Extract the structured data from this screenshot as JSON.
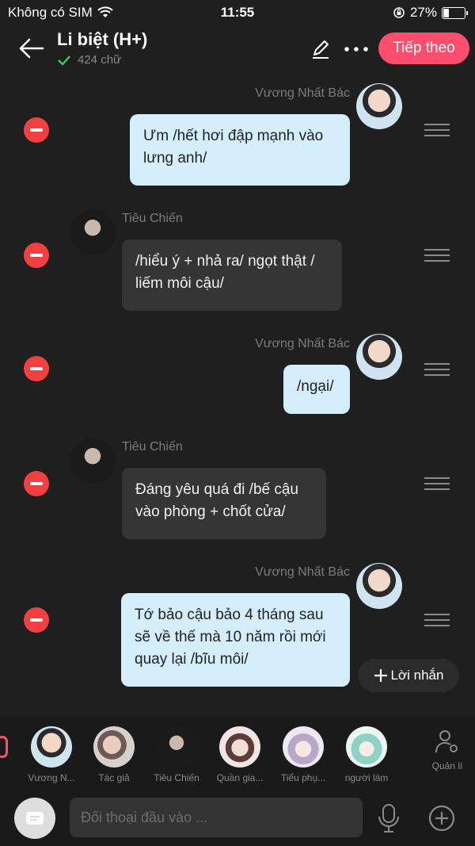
{
  "status": {
    "carrier": "Không có SIM",
    "time": "11:55",
    "battery": "27%"
  },
  "header": {
    "title": "Li biệt (H+)",
    "word_count": "424 chữ",
    "next_label": "Tiếp theo"
  },
  "messages": [
    {
      "sender": "Vương Nhất Bác",
      "text": "Ưm /hết hơi đập mạnh vào lưng anh/",
      "side": "right"
    },
    {
      "sender": "Tiêu Chiến",
      "text": "/hiểu ý + nhả ra/ ngọt thật / liếm môi cậu/",
      "side": "left"
    },
    {
      "sender": "Vương Nhất Bác",
      "text": "/ngại/",
      "side": "right"
    },
    {
      "sender": "Tiêu Chiến",
      "text": "Đáng yêu quá đi /bế cậu vào phòng + chốt cửa/",
      "side": "left"
    },
    {
      "sender": "Vương Nhất Bác",
      "text": "Tớ bảo cậu bảo 4 tháng sau sẽ về thế mà 10 năm rồi mới quay lại /bĩu môi/",
      "side": "right"
    }
  ],
  "add_message_label": "Lời nhắn",
  "characters": [
    {
      "name": "Vương N..."
    },
    {
      "name": "Tác giả"
    },
    {
      "name": "Tiêu Chiến"
    },
    {
      "name": "Quần gia..."
    },
    {
      "name": "Tiểu phụ..."
    },
    {
      "name": "người làm"
    }
  ],
  "manage_label": "Quản lí",
  "input": {
    "placeholder": "Đối thoại đầu vào ..."
  },
  "colors": {
    "accent": "#ff4d6d",
    "bubble_right": "#d4eefc",
    "bubble_left": "#353535",
    "delete": "#f04040"
  }
}
